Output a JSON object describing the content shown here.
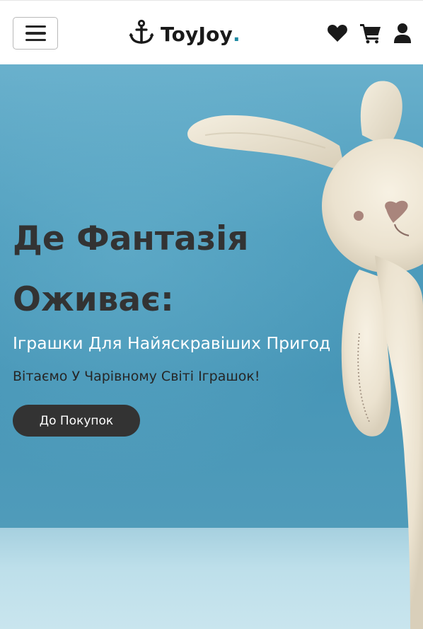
{
  "navbar": {
    "brand_name": "ToyJoy",
    "brand_dot": ".",
    "icons": [
      "menu-icon",
      "anchor-icon",
      "heart-icon",
      "cart-icon",
      "user-icon"
    ]
  },
  "hero": {
    "title_line1": "Де Фантазія",
    "title_line2": "Оживає:",
    "subtitle": "Іграшки Для Найяскравіших Пригод",
    "welcome": "Вітаємо У Чарівному Світі Іграшок!",
    "cta_label": "До Покупок"
  },
  "colors": {
    "accent": "#1f8aa3",
    "button_bg": "#333333",
    "hero_bg": "#4e9dbd"
  }
}
